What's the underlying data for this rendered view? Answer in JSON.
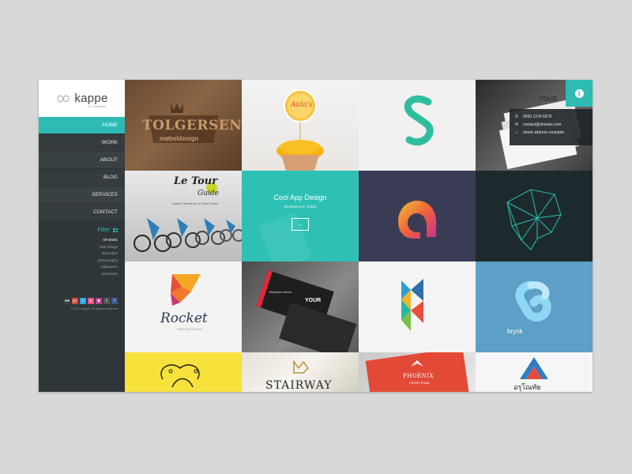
{
  "brand": {
    "name": "kappe",
    "tagline": "UX creatives"
  },
  "nav": [
    {
      "label": "HOME",
      "active": true
    },
    {
      "label": "WORK",
      "active": false
    },
    {
      "label": "ABOUT",
      "active": false
    },
    {
      "label": "BLOG",
      "active": false
    },
    {
      "label": "SERVICES",
      "active": false
    },
    {
      "label": "CONTACT",
      "active": false
    }
  ],
  "filter": {
    "title": "Filter",
    "items": [
      "All Works",
      "web design",
      "illustration",
      "photography",
      "wallpapers",
      "brochures"
    ]
  },
  "socials": [
    "flickr-icon",
    "google-plus-icon",
    "twitter-icon",
    "dribbble-icon",
    "instagram-icon",
    "tumblr-icon",
    "facebook-icon"
  ],
  "copyright": "© 2014 Kappe. All Rights Reserved",
  "contact": {
    "phone": "9930 1234 6679",
    "email": "contact@domain.com",
    "address": "street address example"
  },
  "featured": {
    "title": "Cool App Design",
    "tags": "development, mobile"
  },
  "tiles": {
    "tolgersen_top": "TOLGERSEN",
    "tolgersen_bottom": "møbeldesign",
    "cupcake_badge": "Aida's",
    "tour_title": "Le Tour",
    "tour_sub": "Guide",
    "tour_caption": "Insiders' Secrets for Le Grand Depart",
    "card_your": "YOUR",
    "rocket": "Rocket",
    "rocket_sub": "CREATIVE STUDIO",
    "card2_name": "Business Name",
    "brynk": "brynk",
    "stairway": "STAIRWAY",
    "phoenix": "PHOENIX",
    "phoenix_sub": "FRONT FUND",
    "thai": "อรุโณทัย"
  },
  "colors": {
    "accent": "#2dbbb4",
    "sidebar": "#2f3639"
  }
}
